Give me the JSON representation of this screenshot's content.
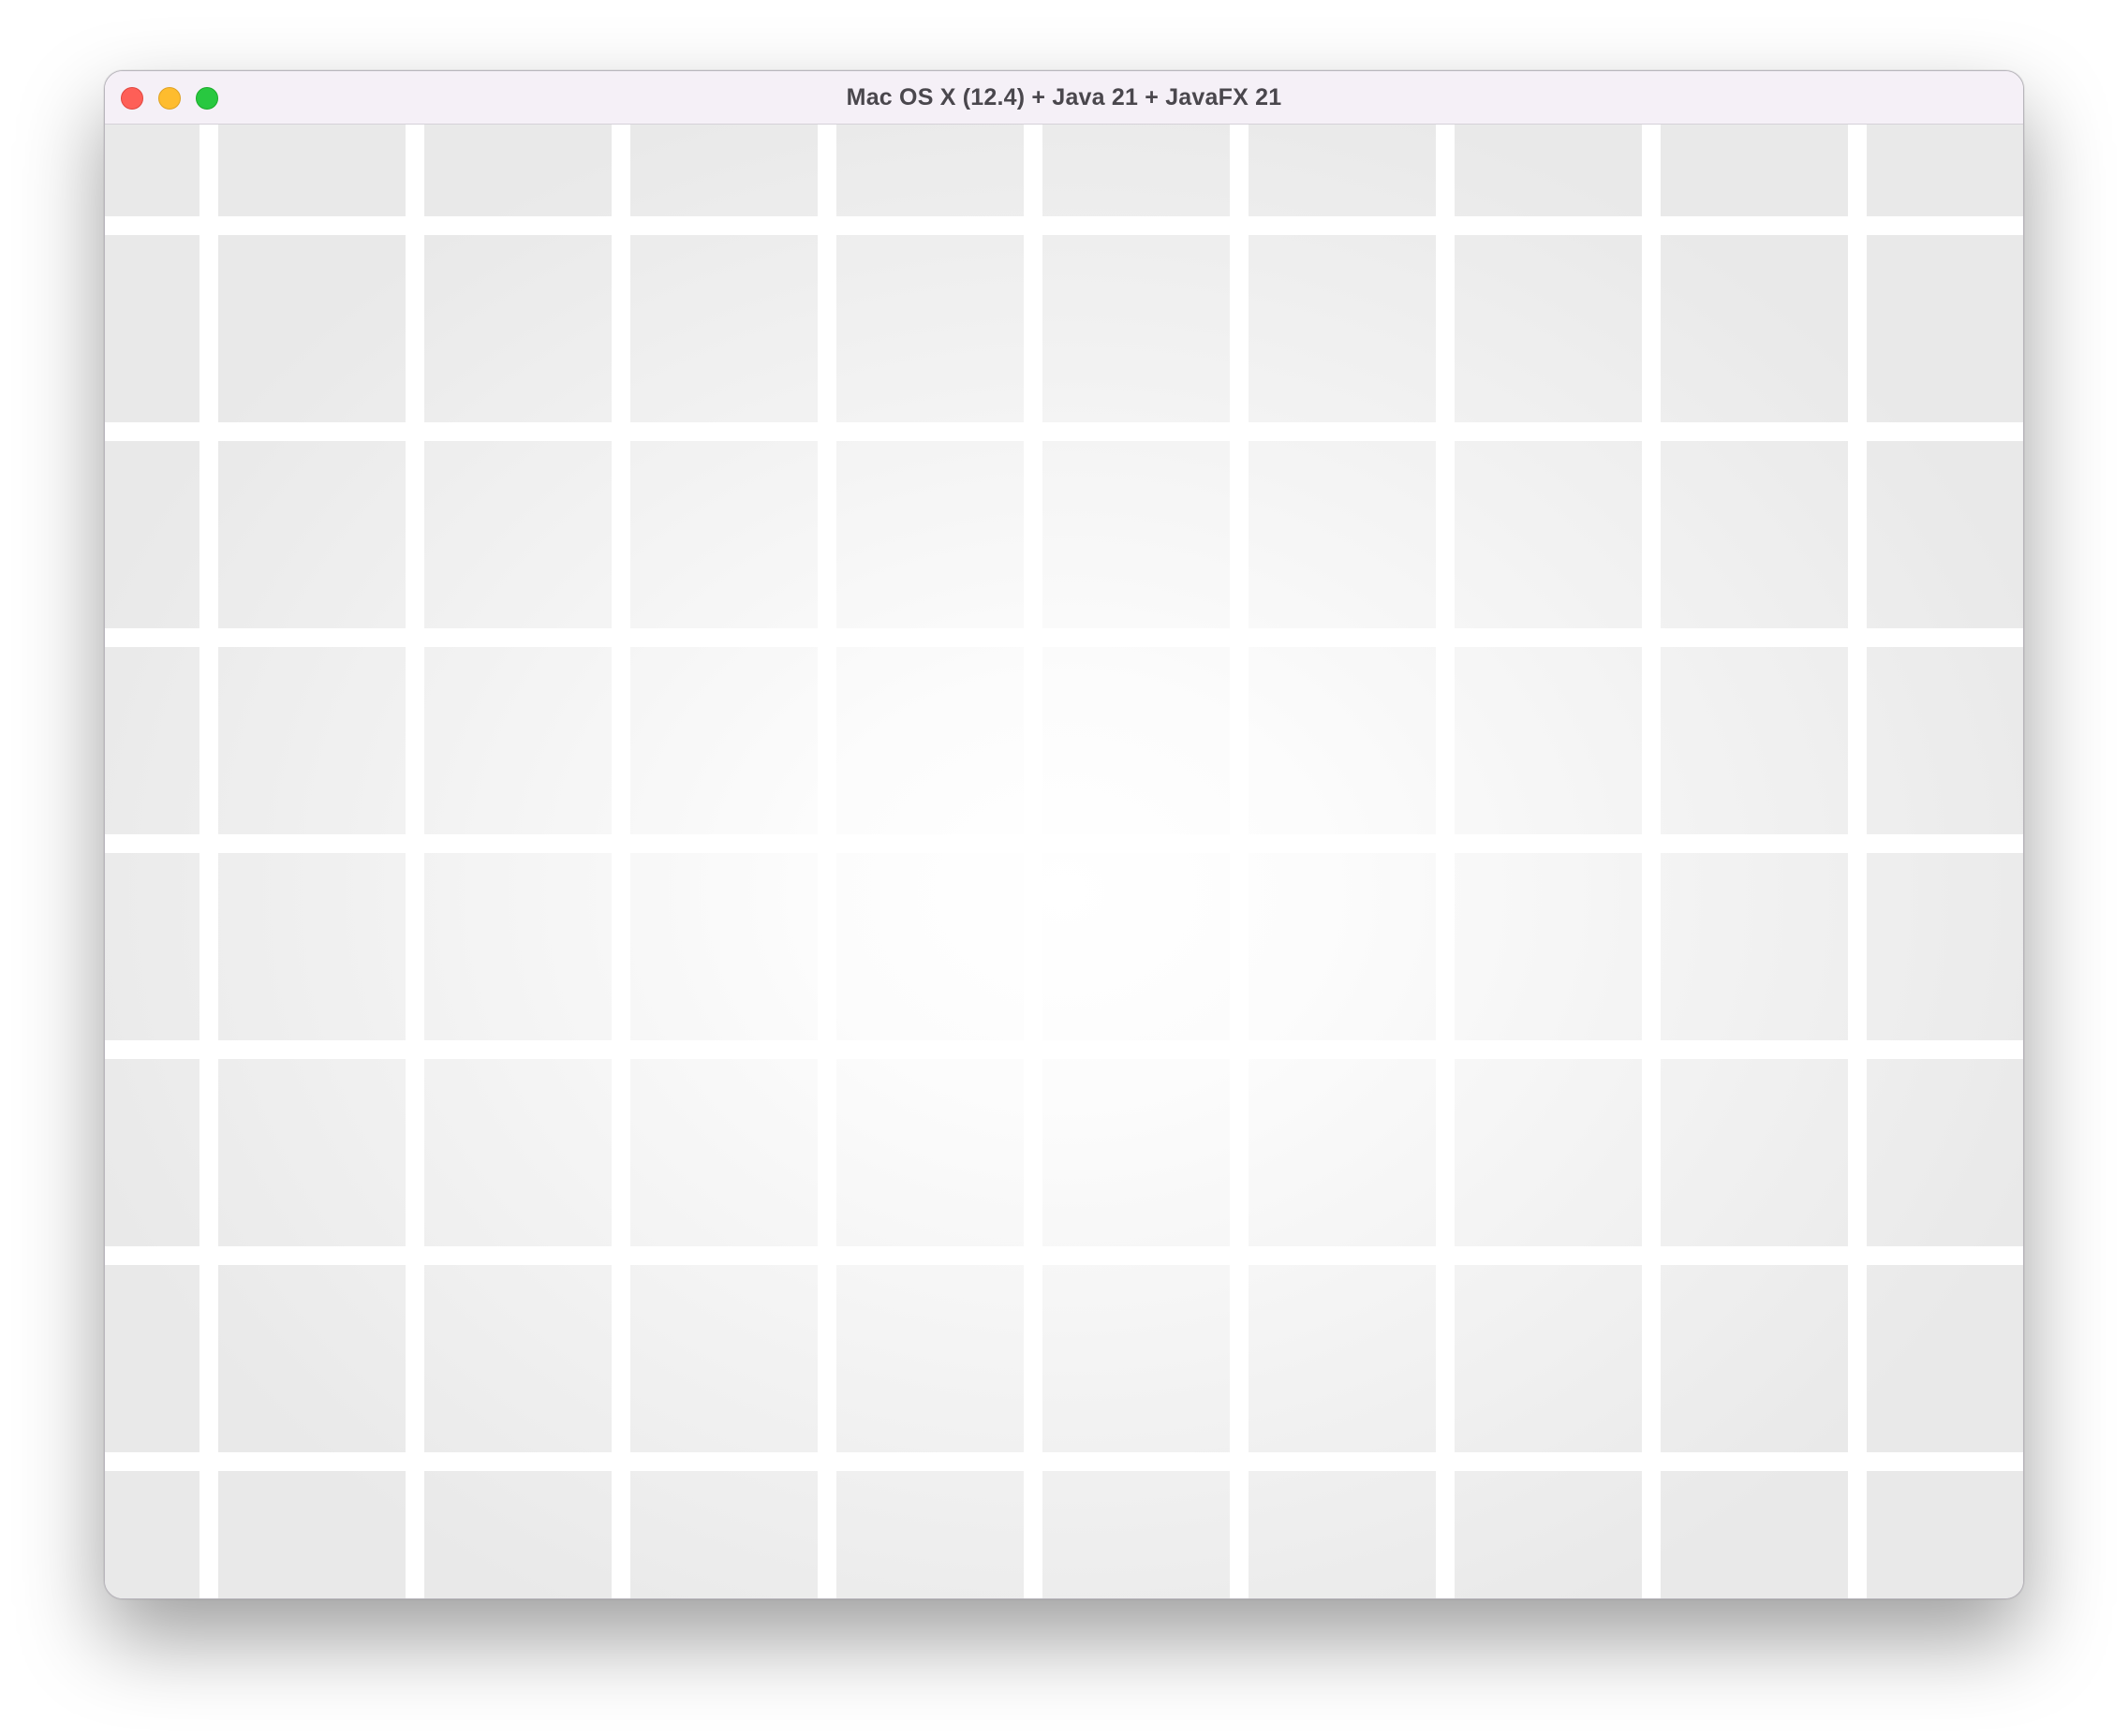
{
  "window": {
    "title": "Mac OS X (12.4) + Java 21 + JavaFX 21",
    "controls": {
      "close": {
        "icon": "close-traffic-light-icon",
        "color": "#fe5f57"
      },
      "minimize": {
        "icon": "minimize-traffic-light-icon",
        "color": "#febc2e"
      },
      "maximize": {
        "icon": "maximize-traffic-light-icon",
        "color": "#28c840"
      }
    }
  },
  "canvas": {
    "background": "radial gradient white center to light gray edges",
    "grid_color": "#ffffff"
  }
}
